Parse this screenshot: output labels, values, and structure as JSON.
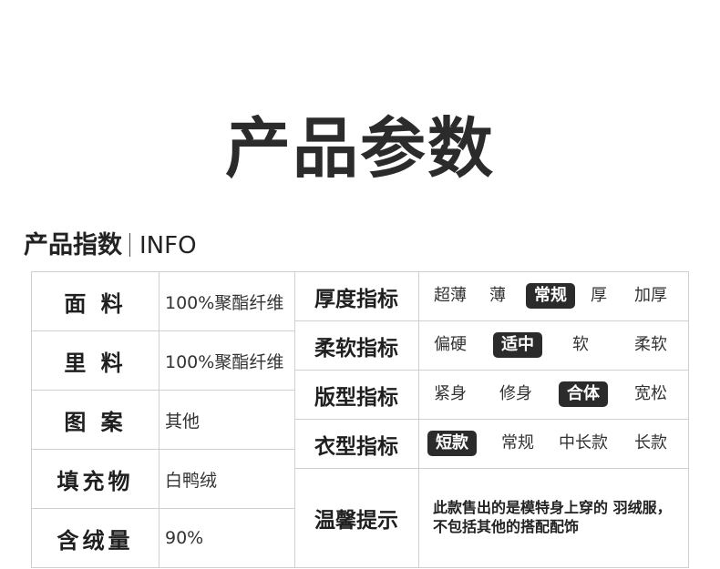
{
  "title": "产品参数",
  "section": {
    "heading": "产品指数",
    "heading_en": "INFO"
  },
  "materials": [
    {
      "label": "面  料",
      "value": "100%聚酯纤维"
    },
    {
      "label": "里  料",
      "value": "100%聚酯纤维"
    },
    {
      "label": "图  案",
      "value": "其他"
    },
    {
      "label": "填充物",
      "value": "白鸭绒"
    },
    {
      "label": "含绒量",
      "value": "90%"
    }
  ],
  "indicators": [
    {
      "label": "厚度指标",
      "options": [
        "超薄",
        "薄",
        "常规",
        "厚",
        "加厚"
      ],
      "selected": "常规"
    },
    {
      "label": "柔软指标",
      "options": [
        "偏硬",
        "适中",
        "软",
        "柔软"
      ],
      "selected": "适中"
    },
    {
      "label": "版型指标",
      "options": [
        "紧身",
        "修身",
        "合体",
        "宽松"
      ],
      "selected": "合体"
    },
    {
      "label": "衣型指标",
      "options": [
        "短款",
        "常规",
        "中长款",
        "长款"
      ],
      "selected": "短款"
    }
  ],
  "tip": {
    "label": "温馨提示",
    "text": "此款售出的是模特身上穿的 羽绒服，不包括其他的搭配配饰"
  },
  "colors": {
    "selected_bg": "#2b2b2b",
    "border": "#cfcfcf"
  }
}
